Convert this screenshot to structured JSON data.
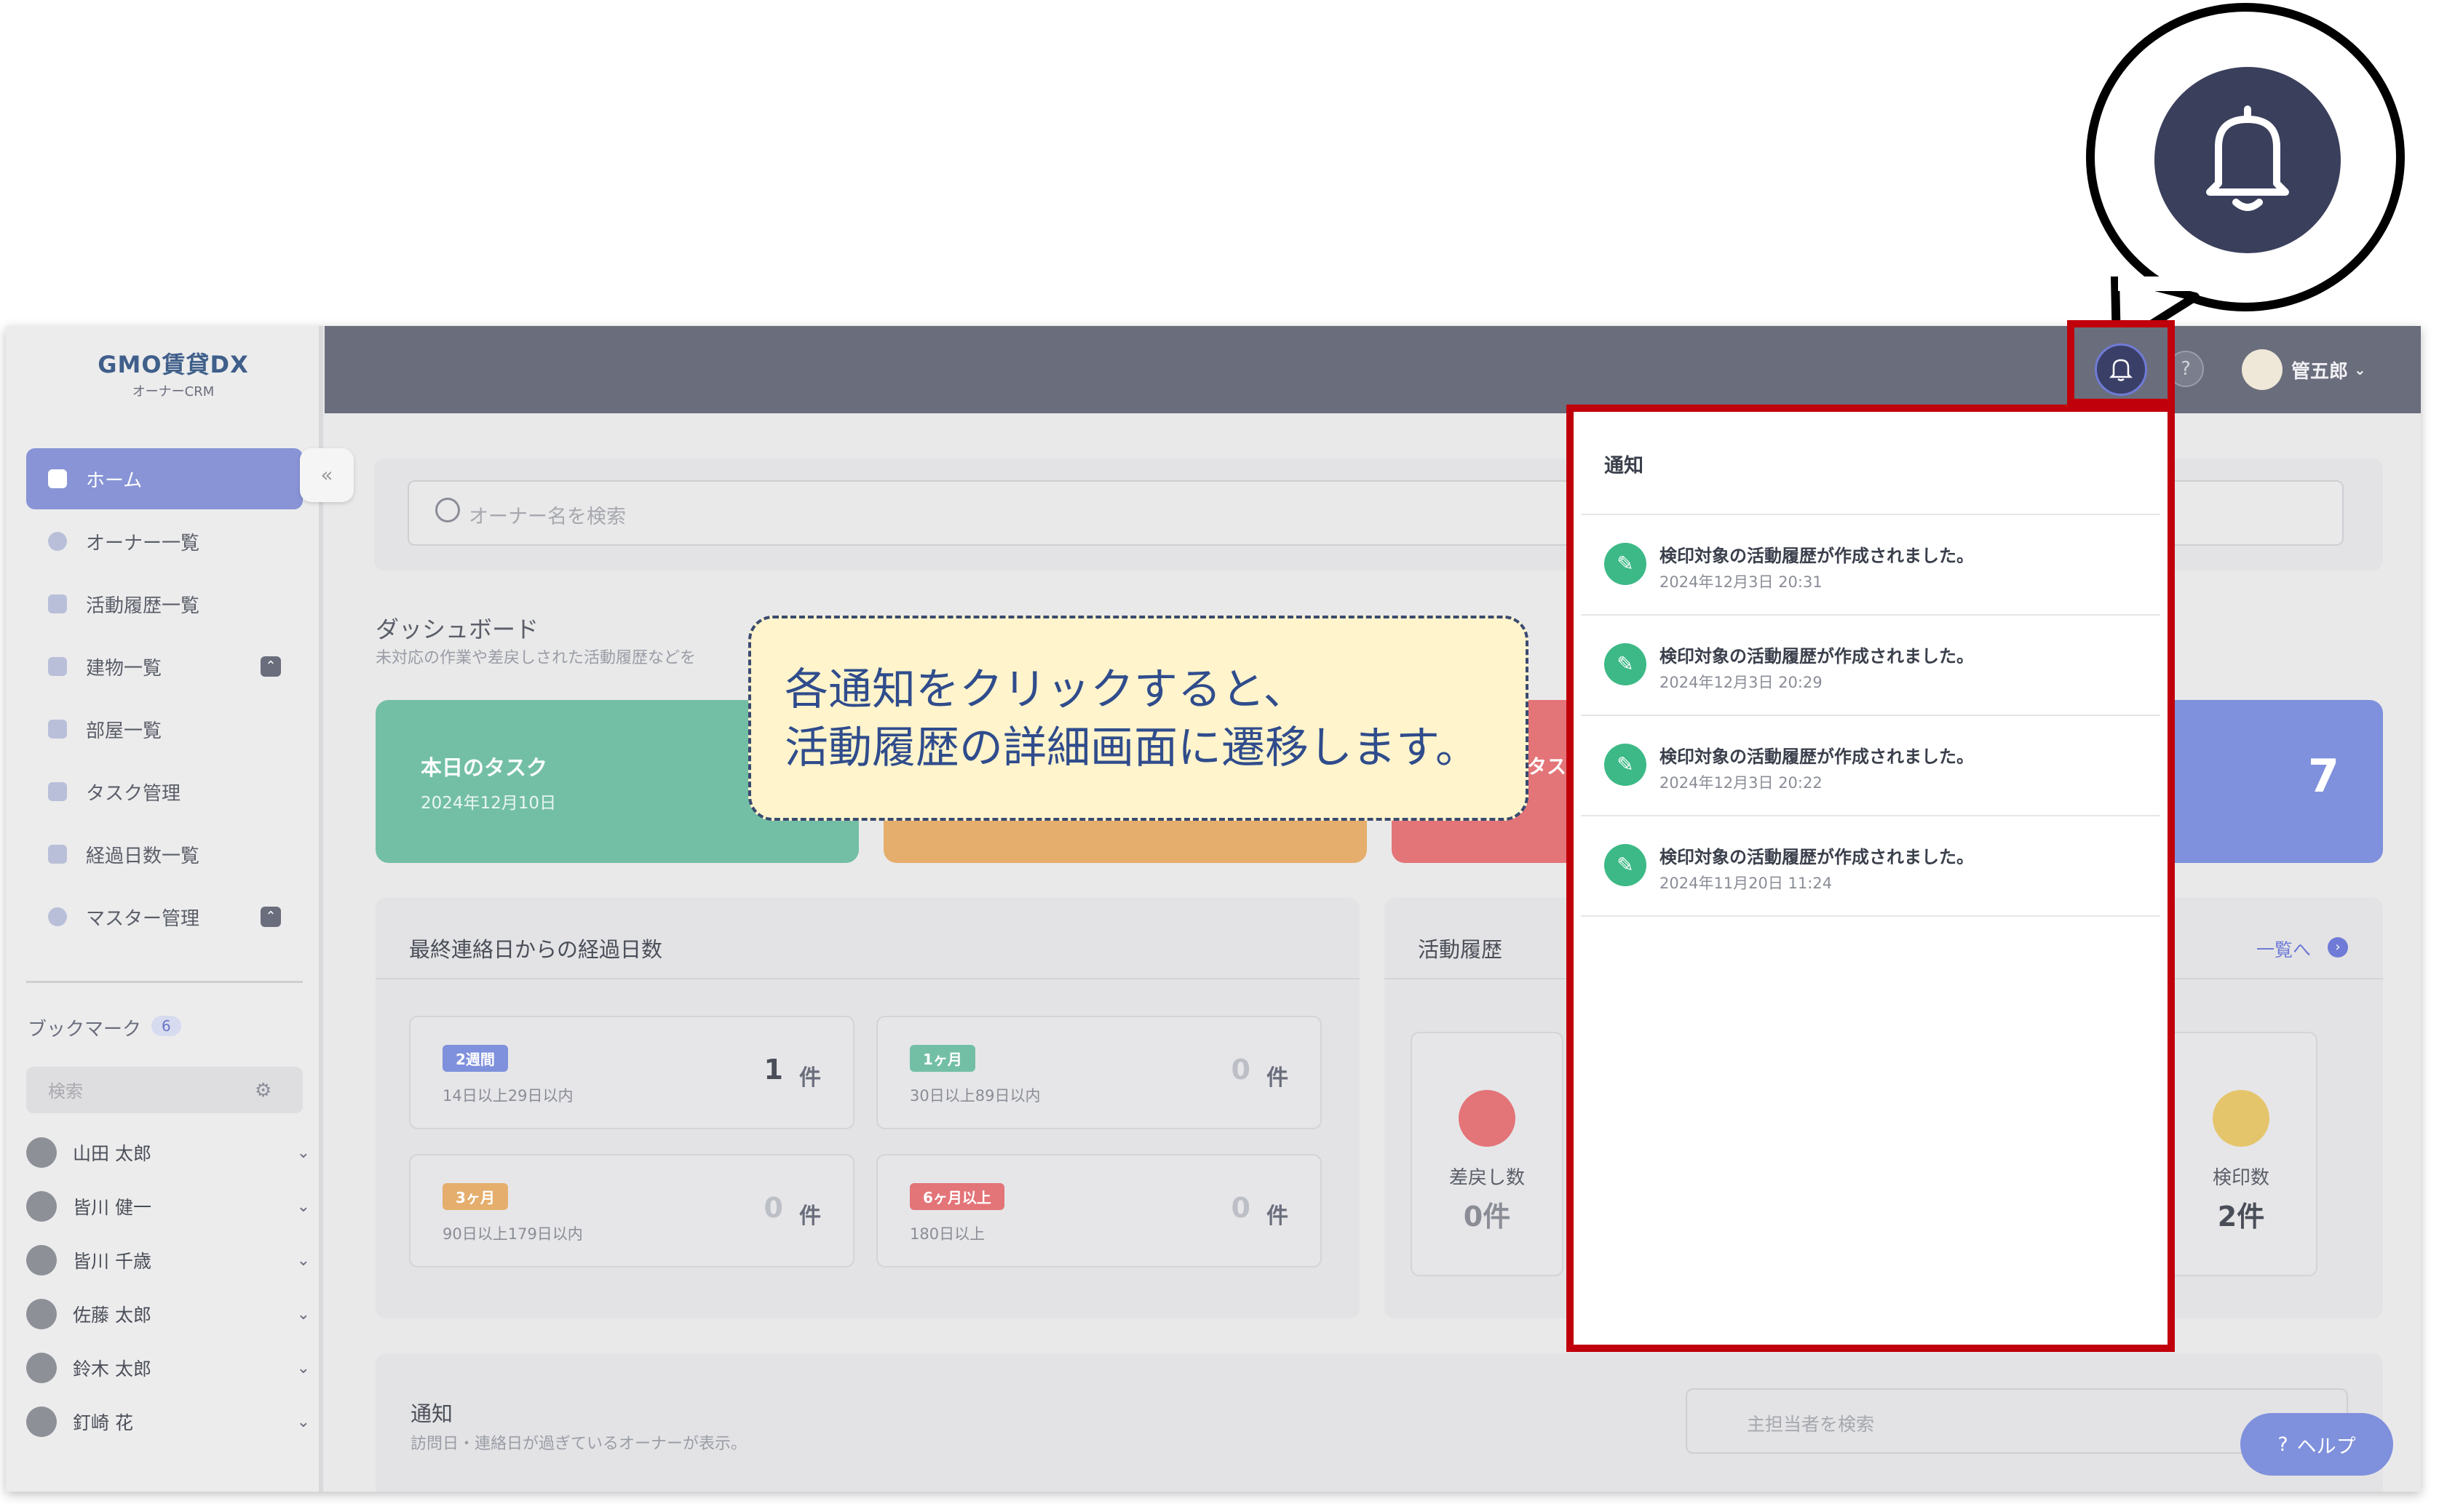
{
  "brand": {
    "name": "GMO賃貸DX",
    "subtitle": "オーナーCRM"
  },
  "sidebar": {
    "items": [
      {
        "label": "ホーム",
        "active": true
      },
      {
        "label": "オーナー一覧"
      },
      {
        "label": "活動履歴一覧"
      },
      {
        "label": "建物一覧",
        "expandable": true
      },
      {
        "label": "部屋一覧"
      },
      {
        "label": "タスク管理"
      },
      {
        "label": "経過日数一覧"
      },
      {
        "label": "マスター管理",
        "expandable": true
      }
    ],
    "bookmarks": {
      "title": "ブックマーク",
      "count": "6",
      "search_placeholder": "検索",
      "people": [
        "山田 太郎",
        "皆川 健一",
        "皆川 千歳",
        "佐藤 太郎",
        "鈴木 太郎",
        "釘崎 花"
      ]
    }
  },
  "header": {
    "user_name": "管五郎"
  },
  "main": {
    "search_placeholder": "オーナー名を検索",
    "dashboard_title": "ダッシュボード",
    "dashboard_sub": "未対応の作業や差戻しされた活動履歴などを",
    "tiles": {
      "today_title": "本日のタスク",
      "today_date": "2024年12月10日",
      "tile3_partial": "タスク",
      "tile4_value": "7"
    },
    "elapsed": {
      "title": "最終連絡日からの経過日数",
      "boxes": [
        {
          "tag": "2週間",
          "range": "14日以上29日以内",
          "count": "1",
          "unit": "件",
          "color": "#7f90dc"
        },
        {
          "tag": "1ヶ月",
          "range": "30日以上89日以内",
          "count": "0",
          "unit": "件",
          "color": "#73bfa5"
        },
        {
          "tag": "3ヶ月",
          "range": "90日以上179日以内",
          "count": "0",
          "unit": "件",
          "color": "#e5ae6c"
        },
        {
          "tag": "6ヶ月以上",
          "range": "180日以上",
          "count": "0",
          "unit": "件",
          "color": "#e37478"
        }
      ]
    },
    "activity": {
      "title": "活動履歴",
      "link": "一覧へ",
      "sendback_label": "差戻し数",
      "sendback_value": "0件",
      "stamp_label": "検印数",
      "stamp_value": "2件"
    },
    "notices": {
      "title": "通知",
      "sub": "訪問日・連絡日が過ぎているオーナーが表示。",
      "search_placeholder": "主担当者を検索"
    },
    "help_label": "ヘルプ"
  },
  "notification_panel": {
    "title": "通知",
    "items": [
      {
        "text": "検印対象の活動履歴が作成されました。",
        "date": "2024年12月3日 20:31"
      },
      {
        "text": "検印対象の活動履歴が作成されました。",
        "date": "2024年12月3日 20:29"
      },
      {
        "text": "検印対象の活動履歴が作成されました。",
        "date": "2024年12月3日 20:22"
      },
      {
        "text": "検印対象の活動履歴が作成されました。",
        "date": "2024年11月20日 11:24"
      }
    ]
  },
  "callout": {
    "line1": "各通知をクリックすると、",
    "line2": "活動履歴の詳細画面に遷移します。"
  },
  "colors": {
    "highlight": "#c0000b",
    "accent": "#7f90dc",
    "callout_bg": "#fff4cc",
    "callout_text": "#2f4c8c"
  }
}
